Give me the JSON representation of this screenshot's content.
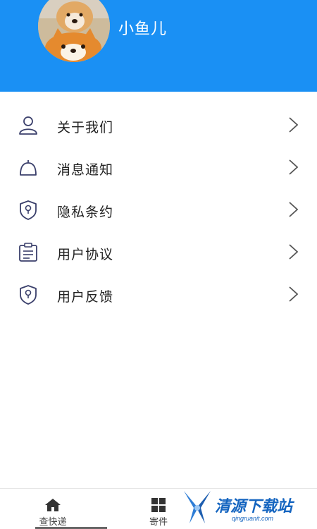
{
  "header": {
    "username": "小鱼儿",
    "background_color": "#1a90f4",
    "avatar_icon": "shiba-dog-avatar"
  },
  "menu": {
    "items": [
      {
        "label": "关于我们",
        "icon": "user-icon"
      },
      {
        "label": "消息通知",
        "icon": "bell-icon"
      },
      {
        "label": "隐私条约",
        "icon": "shield-icon"
      },
      {
        "label": "用户协议",
        "icon": "clipboard-icon"
      },
      {
        "label": "用户反馈",
        "icon": "shield-icon"
      }
    ]
  },
  "tabbar": {
    "tabs": [
      {
        "label": "查快递",
        "icon": "home-icon"
      },
      {
        "label": "寄件",
        "icon": "grid-icon"
      }
    ]
  },
  "watermark": {
    "text": "清源下载站",
    "url": "qingruanit.com",
    "color": "#1565c0"
  }
}
